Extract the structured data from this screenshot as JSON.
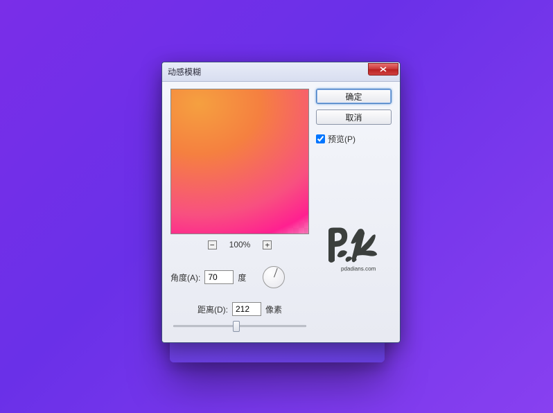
{
  "dialog": {
    "title": "动感模糊",
    "buttons": {
      "ok": "确定",
      "cancel": "取消"
    },
    "preview": {
      "label": "预览(P)",
      "checked": true
    },
    "zoom": {
      "level": "100%",
      "minus": "-",
      "plus": "+"
    },
    "angle": {
      "label": "角度(A):",
      "value": "70",
      "unit": "度"
    },
    "distance": {
      "label": "距离(D):",
      "value": "212",
      "unit": "像素"
    },
    "watermark": "pdadians.com"
  }
}
